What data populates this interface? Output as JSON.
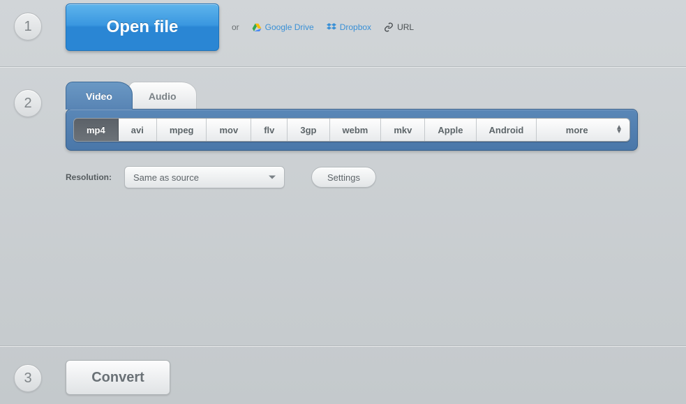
{
  "steps": {
    "s1": "1",
    "s2": "2",
    "s3": "3"
  },
  "open": {
    "button": "Open file",
    "or": "or",
    "gdrive": "Google Drive",
    "dropbox": "Dropbox",
    "url": "URL"
  },
  "tabs": {
    "video": "Video",
    "audio": "Audio"
  },
  "formats": {
    "mp4": "mp4",
    "avi": "avi",
    "mpeg": "mpeg",
    "mov": "mov",
    "flv": "flv",
    "gp3": "3gp",
    "webm": "webm",
    "mkv": "mkv",
    "apple": "Apple",
    "android": "Android",
    "more": "more"
  },
  "resolution": {
    "label": "Resolution:",
    "value": "Same as source"
  },
  "settings_btn": "Settings",
  "convert_btn": "Convert"
}
